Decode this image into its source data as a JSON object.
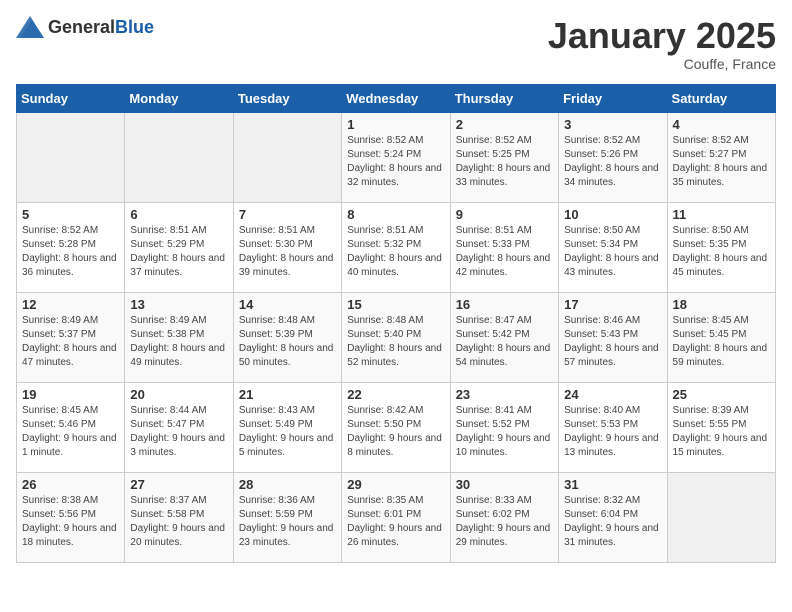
{
  "header": {
    "logo_general": "General",
    "logo_blue": "Blue",
    "month_title": "January 2025",
    "location": "Couffe, France"
  },
  "calendar": {
    "days_of_week": [
      "Sunday",
      "Monday",
      "Tuesday",
      "Wednesday",
      "Thursday",
      "Friday",
      "Saturday"
    ],
    "weeks": [
      [
        {
          "day": "",
          "sunrise": "",
          "sunset": "",
          "daylight": "",
          "empty": true
        },
        {
          "day": "",
          "sunrise": "",
          "sunset": "",
          "daylight": "",
          "empty": true
        },
        {
          "day": "",
          "sunrise": "",
          "sunset": "",
          "daylight": "",
          "empty": true
        },
        {
          "day": "1",
          "sunrise": "Sunrise: 8:52 AM",
          "sunset": "Sunset: 5:24 PM",
          "daylight": "Daylight: 8 hours and 32 minutes."
        },
        {
          "day": "2",
          "sunrise": "Sunrise: 8:52 AM",
          "sunset": "Sunset: 5:25 PM",
          "daylight": "Daylight: 8 hours and 33 minutes."
        },
        {
          "day": "3",
          "sunrise": "Sunrise: 8:52 AM",
          "sunset": "Sunset: 5:26 PM",
          "daylight": "Daylight: 8 hours and 34 minutes."
        },
        {
          "day": "4",
          "sunrise": "Sunrise: 8:52 AM",
          "sunset": "Sunset: 5:27 PM",
          "daylight": "Daylight: 8 hours and 35 minutes."
        }
      ],
      [
        {
          "day": "5",
          "sunrise": "Sunrise: 8:52 AM",
          "sunset": "Sunset: 5:28 PM",
          "daylight": "Daylight: 8 hours and 36 minutes."
        },
        {
          "day": "6",
          "sunrise": "Sunrise: 8:51 AM",
          "sunset": "Sunset: 5:29 PM",
          "daylight": "Daylight: 8 hours and 37 minutes."
        },
        {
          "day": "7",
          "sunrise": "Sunrise: 8:51 AM",
          "sunset": "Sunset: 5:30 PM",
          "daylight": "Daylight: 8 hours and 39 minutes."
        },
        {
          "day": "8",
          "sunrise": "Sunrise: 8:51 AM",
          "sunset": "Sunset: 5:32 PM",
          "daylight": "Daylight: 8 hours and 40 minutes."
        },
        {
          "day": "9",
          "sunrise": "Sunrise: 8:51 AM",
          "sunset": "Sunset: 5:33 PM",
          "daylight": "Daylight: 8 hours and 42 minutes."
        },
        {
          "day": "10",
          "sunrise": "Sunrise: 8:50 AM",
          "sunset": "Sunset: 5:34 PM",
          "daylight": "Daylight: 8 hours and 43 minutes."
        },
        {
          "day": "11",
          "sunrise": "Sunrise: 8:50 AM",
          "sunset": "Sunset: 5:35 PM",
          "daylight": "Daylight: 8 hours and 45 minutes."
        }
      ],
      [
        {
          "day": "12",
          "sunrise": "Sunrise: 8:49 AM",
          "sunset": "Sunset: 5:37 PM",
          "daylight": "Daylight: 8 hours and 47 minutes."
        },
        {
          "day": "13",
          "sunrise": "Sunrise: 8:49 AM",
          "sunset": "Sunset: 5:38 PM",
          "daylight": "Daylight: 8 hours and 49 minutes."
        },
        {
          "day": "14",
          "sunrise": "Sunrise: 8:48 AM",
          "sunset": "Sunset: 5:39 PM",
          "daylight": "Daylight: 8 hours and 50 minutes."
        },
        {
          "day": "15",
          "sunrise": "Sunrise: 8:48 AM",
          "sunset": "Sunset: 5:40 PM",
          "daylight": "Daylight: 8 hours and 52 minutes."
        },
        {
          "day": "16",
          "sunrise": "Sunrise: 8:47 AM",
          "sunset": "Sunset: 5:42 PM",
          "daylight": "Daylight: 8 hours and 54 minutes."
        },
        {
          "day": "17",
          "sunrise": "Sunrise: 8:46 AM",
          "sunset": "Sunset: 5:43 PM",
          "daylight": "Daylight: 8 hours and 57 minutes."
        },
        {
          "day": "18",
          "sunrise": "Sunrise: 8:45 AM",
          "sunset": "Sunset: 5:45 PM",
          "daylight": "Daylight: 8 hours and 59 minutes."
        }
      ],
      [
        {
          "day": "19",
          "sunrise": "Sunrise: 8:45 AM",
          "sunset": "Sunset: 5:46 PM",
          "daylight": "Daylight: 9 hours and 1 minute."
        },
        {
          "day": "20",
          "sunrise": "Sunrise: 8:44 AM",
          "sunset": "Sunset: 5:47 PM",
          "daylight": "Daylight: 9 hours and 3 minutes."
        },
        {
          "day": "21",
          "sunrise": "Sunrise: 8:43 AM",
          "sunset": "Sunset: 5:49 PM",
          "daylight": "Daylight: 9 hours and 5 minutes."
        },
        {
          "day": "22",
          "sunrise": "Sunrise: 8:42 AM",
          "sunset": "Sunset: 5:50 PM",
          "daylight": "Daylight: 9 hours and 8 minutes."
        },
        {
          "day": "23",
          "sunrise": "Sunrise: 8:41 AM",
          "sunset": "Sunset: 5:52 PM",
          "daylight": "Daylight: 9 hours and 10 minutes."
        },
        {
          "day": "24",
          "sunrise": "Sunrise: 8:40 AM",
          "sunset": "Sunset: 5:53 PM",
          "daylight": "Daylight: 9 hours and 13 minutes."
        },
        {
          "day": "25",
          "sunrise": "Sunrise: 8:39 AM",
          "sunset": "Sunset: 5:55 PM",
          "daylight": "Daylight: 9 hours and 15 minutes."
        }
      ],
      [
        {
          "day": "26",
          "sunrise": "Sunrise: 8:38 AM",
          "sunset": "Sunset: 5:56 PM",
          "daylight": "Daylight: 9 hours and 18 minutes."
        },
        {
          "day": "27",
          "sunrise": "Sunrise: 8:37 AM",
          "sunset": "Sunset: 5:58 PM",
          "daylight": "Daylight: 9 hours and 20 minutes."
        },
        {
          "day": "28",
          "sunrise": "Sunrise: 8:36 AM",
          "sunset": "Sunset: 5:59 PM",
          "daylight": "Daylight: 9 hours and 23 minutes."
        },
        {
          "day": "29",
          "sunrise": "Sunrise: 8:35 AM",
          "sunset": "Sunset: 6:01 PM",
          "daylight": "Daylight: 9 hours and 26 minutes."
        },
        {
          "day": "30",
          "sunrise": "Sunrise: 8:33 AM",
          "sunset": "Sunset: 6:02 PM",
          "daylight": "Daylight: 9 hours and 29 minutes."
        },
        {
          "day": "31",
          "sunrise": "Sunrise: 8:32 AM",
          "sunset": "Sunset: 6:04 PM",
          "daylight": "Daylight: 9 hours and 31 minutes."
        },
        {
          "day": "",
          "sunrise": "",
          "sunset": "",
          "daylight": "",
          "empty": true
        }
      ]
    ]
  }
}
